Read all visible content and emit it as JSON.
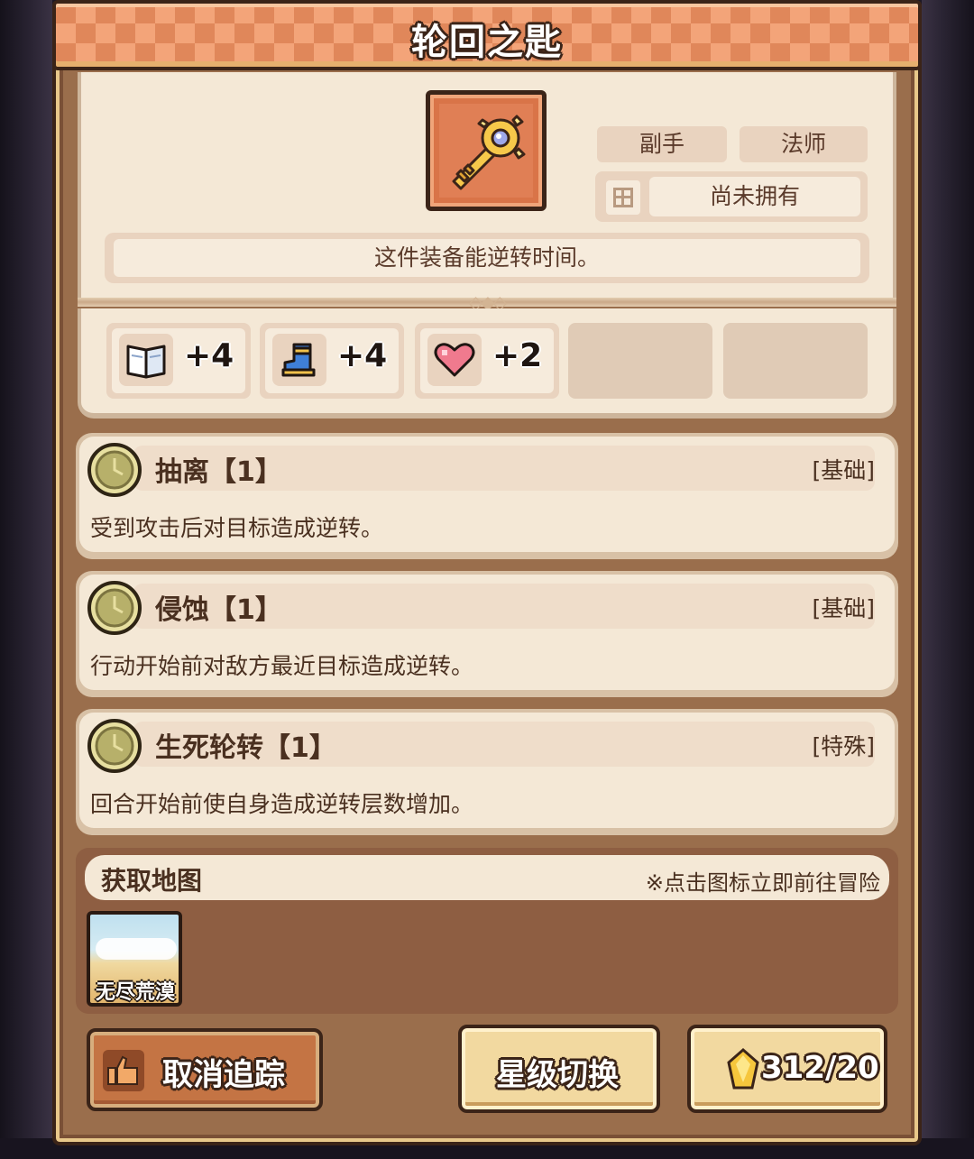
{
  "title": "轮回之匙",
  "item": {
    "icon": "golden-key-icon",
    "tags": [
      "副手",
      "法师"
    ],
    "ownership": "尚未拥有",
    "description": "这件装备能逆转时间。"
  },
  "stats": [
    {
      "icon": "book-icon",
      "value": "+4"
    },
    {
      "icon": "boot-icon",
      "value": "+4"
    },
    {
      "icon": "heart-icon",
      "value": "+2"
    },
    {
      "icon": "",
      "value": ""
    },
    {
      "icon": "",
      "value": ""
    }
  ],
  "skills": [
    {
      "name": "抽离【1】",
      "type": "[基础]",
      "description": "受到攻击后对目标造成逆转。"
    },
    {
      "name": "侵蚀【1】",
      "type": "[基础]",
      "description": "行动开始前对敌方最近目标造成逆转。"
    },
    {
      "name": "生死轮转【1】",
      "type": "[特殊]",
      "description": "回合开始前使自身造成逆转层数增加。"
    }
  ],
  "acquire": {
    "title": "获取地图",
    "hint": "※点击图标立即前往冒险",
    "maps": [
      {
        "name": "无尽荒漠",
        "icon": "desert-map-icon"
      }
    ]
  },
  "buttons": {
    "cancel_track": "取消追踪",
    "star_switch": "星级切换",
    "cost": "312/20",
    "cost_icon": "gold-gem-icon"
  },
  "colors": {
    "title_bar": "#e0875a",
    "panel": "#f4e8d6",
    "frame": "#9a6e4c",
    "outline": "#3b2418"
  }
}
